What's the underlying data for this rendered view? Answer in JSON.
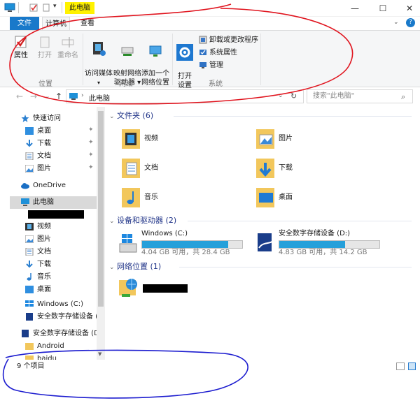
{
  "titlebar": {
    "title": "此电脑",
    "controls": [
      "—",
      "☐",
      "✕"
    ]
  },
  "tabs": [
    {
      "label": "文件"
    },
    {
      "label": "计算机"
    },
    {
      "label": "查看"
    }
  ],
  "ribbon": {
    "location": {
      "label": "位置",
      "buttons": [
        {
          "label": "属性",
          "icon": "properties-check-icon"
        },
        {
          "label": "打开",
          "icon": "open-icon"
        },
        {
          "label": "重命名",
          "icon": "rename-icon"
        }
      ]
    },
    "network": {
      "label": "网络",
      "buttons": [
        {
          "label": "访问媒体",
          "icon": "media-icon"
        },
        {
          "label": "映射网络\n驱动器 ▾",
          "icon": "map-drive-icon"
        },
        {
          "label": "添加一个\n网络位置",
          "icon": "add-network-location-icon"
        }
      ]
    },
    "system": {
      "label": "系统",
      "open_settings": "打开\n设置",
      "items": [
        {
          "label": "卸载或更改程序",
          "icon": "uninstall-icon"
        },
        {
          "label": "系统属性",
          "icon": "system-properties-icon"
        },
        {
          "label": "管理",
          "icon": "manage-icon"
        }
      ]
    }
  },
  "address": {
    "path_root": "此电脑",
    "search_placeholder": "搜索\"此电脑\""
  },
  "nav": {
    "quick_access": "快速访问",
    "quick_items": [
      "桌面",
      "下载",
      "文档",
      "图片"
    ],
    "onedrive": "OneDrive",
    "this_pc": "此电脑",
    "pc_items": [
      "视频",
      "图片",
      "文档",
      "下载",
      "音乐",
      "桌面",
      "Windows (C:)",
      "安全数字存储设备 (D"
    ],
    "drive_d": "安全数字存储设备 (D:)",
    "drive_d_items": [
      "Android",
      "baidu"
    ]
  },
  "content": {
    "folders_header": "文件夹 (6)",
    "folders": [
      {
        "name": "视频",
        "icon": "videos-folder-icon"
      },
      {
        "name": "图片",
        "icon": "pictures-folder-icon"
      },
      {
        "name": "文档",
        "icon": "documents-folder-icon"
      },
      {
        "name": "下载",
        "icon": "downloads-folder-icon"
      },
      {
        "name": "音乐",
        "icon": "music-folder-icon"
      },
      {
        "name": "桌面",
        "icon": "desktop-folder-icon"
      }
    ],
    "drives_header": "设备和驱动器 (2)",
    "drives": [
      {
        "name": "Windows (C:)",
        "free": "4.04 GB 可用，共 28.4 GB",
        "used_fraction": 0.86,
        "icon": "windows-drive-icon"
      },
      {
        "name": "安全数字存储设备 (D:)",
        "free": "4.83 GB 可用，共 14.2 GB",
        "used_fraction": 0.66,
        "icon": "sd-card-drive-icon"
      }
    ],
    "network_header": "网络位置 (1)"
  },
  "status": {
    "count": "9 个项目"
  },
  "colors": {
    "accent": "#1979ca",
    "drive_bar": "#26a0da",
    "highlight": "#fff200",
    "annotation_red": "#e0141e",
    "annotation_blue": "#1c1ccf"
  }
}
